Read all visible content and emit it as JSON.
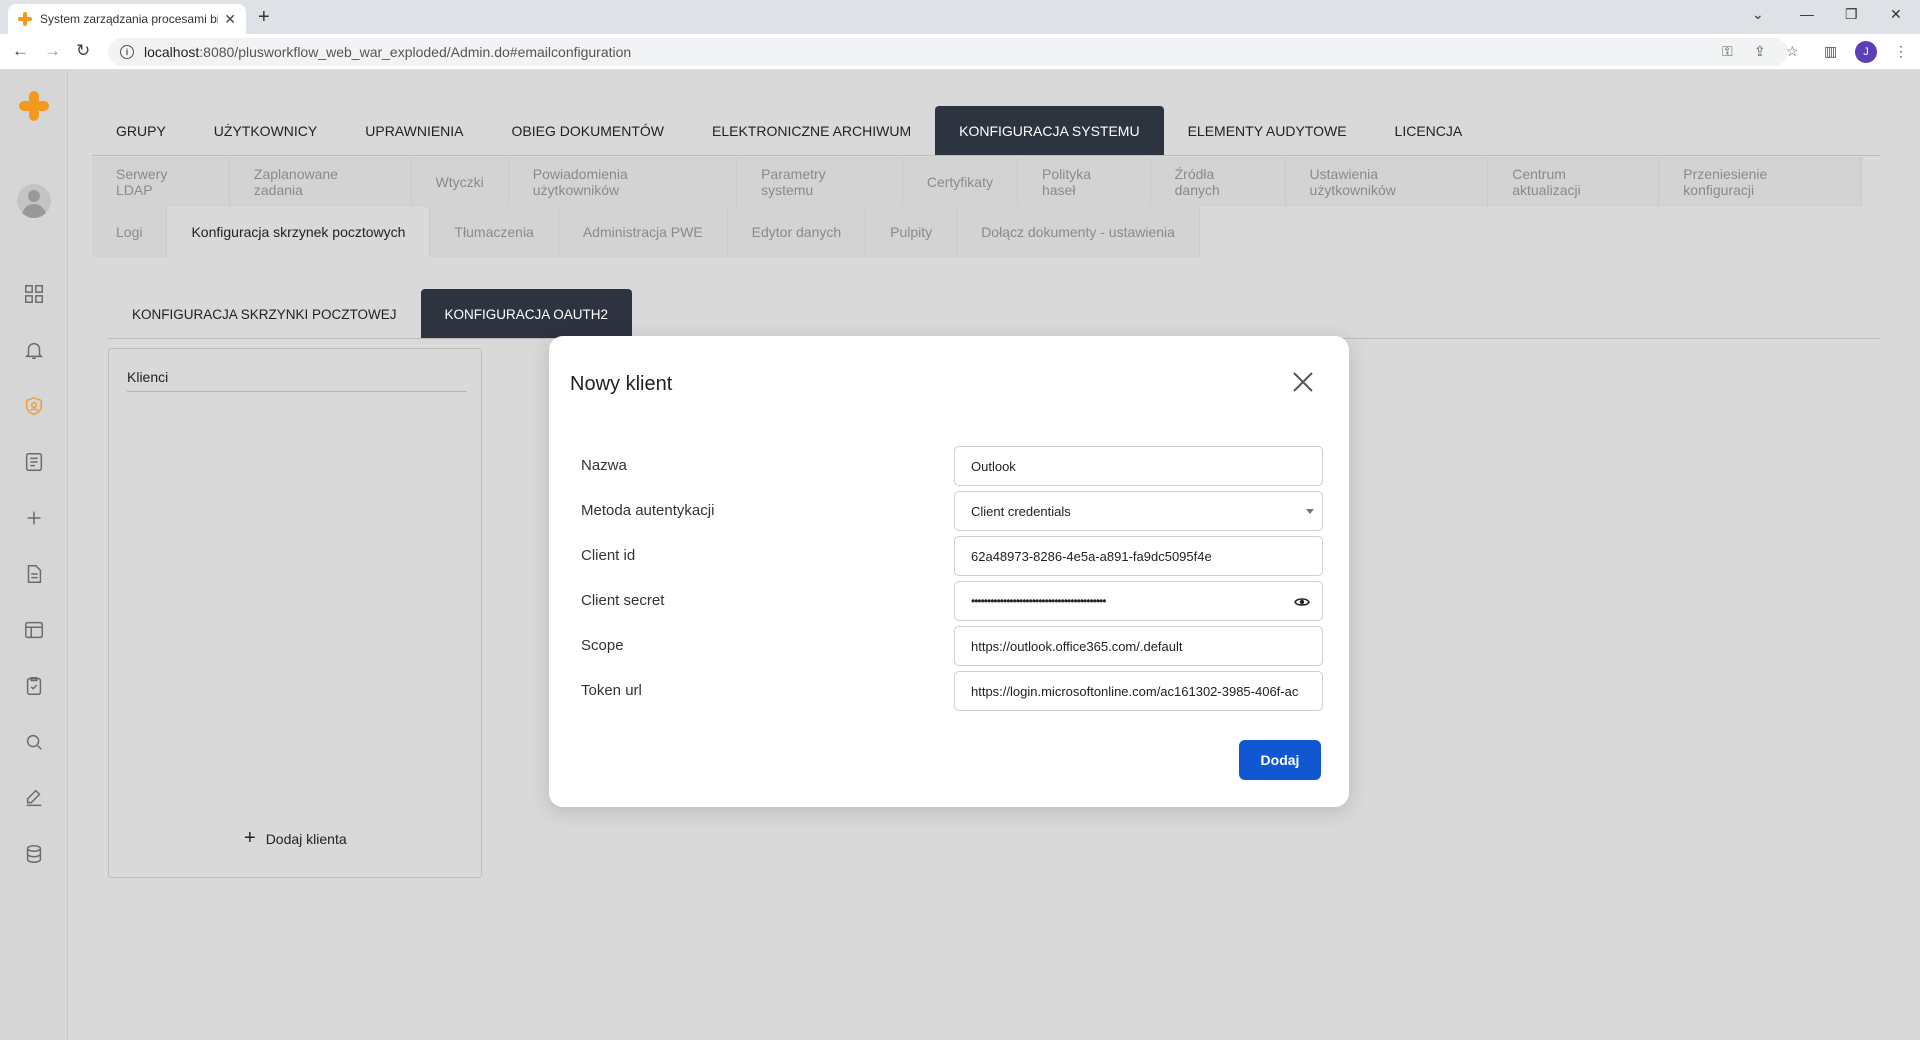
{
  "browser": {
    "tab_title": "System zarządzania procesami bi",
    "url_host": "localhost",
    "url_rest": ":8080/plusworkflow_web_war_exploded/Admin.do#emailconfiguration",
    "profile_initial": "J"
  },
  "main_nav": [
    {
      "label": "GRUPY"
    },
    {
      "label": "UŻYTKOWNICY"
    },
    {
      "label": "UPRAWNIENIA"
    },
    {
      "label": "OBIEG DOKUMENTÓW"
    },
    {
      "label": "ELEKTRONICZNE ARCHIWUM"
    },
    {
      "label": "KONFIGURACJA SYSTEMU"
    },
    {
      "label": "ELEMENTY AUDYTOWE"
    },
    {
      "label": "LICENCJA"
    }
  ],
  "sub_nav_row1": [
    {
      "label": "Serwery LDAP"
    },
    {
      "label": "Zaplanowane zadania"
    },
    {
      "label": "Wtyczki"
    },
    {
      "label": "Powiadomienia użytkowników"
    },
    {
      "label": "Parametry systemu"
    },
    {
      "label": "Certyfikaty"
    },
    {
      "label": "Polityka haseł"
    },
    {
      "label": "Źródła danych"
    },
    {
      "label": "Ustawienia użytkowników"
    },
    {
      "label": "Centrum aktualizacji"
    },
    {
      "label": "Przeniesienie konfiguracji"
    }
  ],
  "sub_nav_row2": [
    {
      "label": "Logi"
    },
    {
      "label": "Konfiguracja skrzynek pocztowych"
    },
    {
      "label": "Tłumaczenia"
    },
    {
      "label": "Administracja PWE"
    },
    {
      "label": "Edytor danych"
    },
    {
      "label": "Pulpity"
    },
    {
      "label": "Dołącz dokumenty - ustawienia"
    }
  ],
  "inner_tabs": [
    {
      "label": "KONFIGURACJA SKRZYNKI POCZTOWEJ"
    },
    {
      "label": "KONFIGURACJA OAUTH2"
    }
  ],
  "clients_panel": {
    "title": "Klienci",
    "add_label": "Dodaj klienta"
  },
  "modal": {
    "title": "Nowy klient",
    "fields": [
      {
        "label": "Nazwa",
        "value": "Outlook"
      },
      {
        "label": "Metoda autentykacji",
        "value": "Client credentials"
      },
      {
        "label": "Client id",
        "value": "62a48973-8286-4e5a-a891-fa9dc5095f4e"
      },
      {
        "label": "Client secret",
        "value": "••••••••••••••••••••••••••••••••••••••••••"
      },
      {
        "label": "Scope",
        "value": "https://outlook.office365.com/.default"
      },
      {
        "label": "Token url",
        "value": "https://login.microsoftonline.com/ac161302-3985-406f-ac"
      }
    ],
    "submit_label": "Dodaj"
  }
}
